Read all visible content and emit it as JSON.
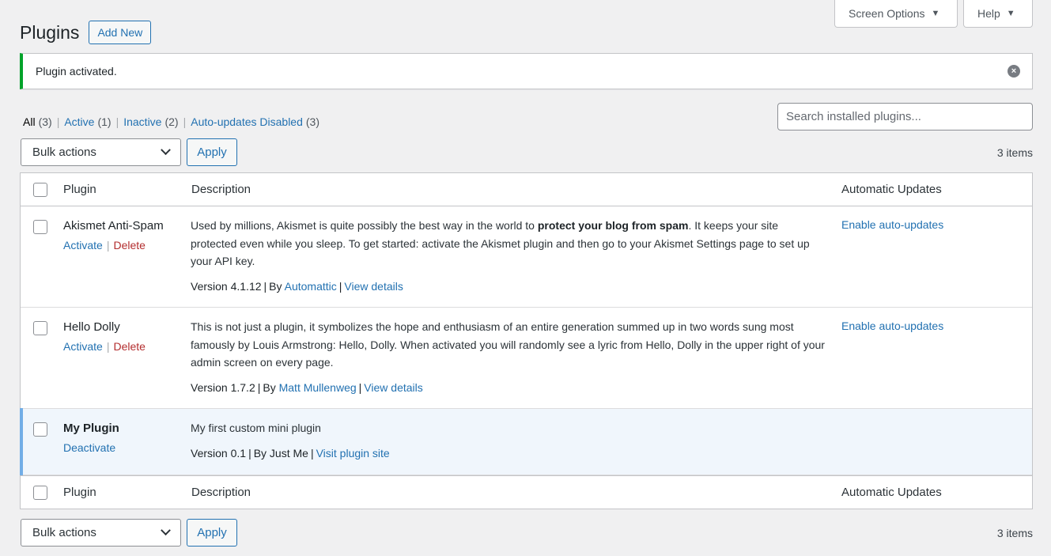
{
  "screen_meta": {
    "screen_options_label": "Screen Options",
    "help_label": "Help"
  },
  "header": {
    "title": "Plugins",
    "add_new_label": "Add New"
  },
  "notice": {
    "message": "Plugin activated.",
    "dismiss_icon": "×"
  },
  "filters": [
    {
      "label": "All",
      "count": "(3)"
    },
    {
      "label": "Active",
      "count": "(1)"
    },
    {
      "label": "Inactive",
      "count": "(2)"
    },
    {
      "label": "Auto-updates Disabled",
      "count": "(3)"
    }
  ],
  "search": {
    "placeholder": "Search installed plugins..."
  },
  "tablenav": {
    "bulk_actions_label": "Bulk actions",
    "apply_label": "Apply",
    "items_count": "3 items"
  },
  "table": {
    "columns": {
      "plugin": "Plugin",
      "description": "Description",
      "auto_updates": "Automatic Updates"
    },
    "rows": [
      {
        "name": "Akismet Anti-Spam",
        "action_primary": "Activate",
        "action_delete": "Delete",
        "desc_before": "Used by millions, Akismet is quite possibly the best way in the world to ",
        "desc_strong": "protect your blog from spam",
        "desc_after": ". It keeps your site protected even while you sleep. To get started: activate the Akismet plugin and then go to your Akismet Settings page to set up your API key.",
        "version": "Version 4.1.12",
        "by": "By",
        "author": "Automattic",
        "details_link": "View details",
        "auto_update_link": "Enable auto-updates"
      },
      {
        "name": "Hello Dolly",
        "action_primary": "Activate",
        "action_delete": "Delete",
        "desc_before": "This is not just a plugin, it symbolizes the hope and enthusiasm of an entire generation summed up in two words sung most famously by Louis Armstrong: Hello, Dolly. When activated you will randomly see a lyric from Hello, Dolly in the upper right of your admin screen on every page.",
        "version": "Version 1.7.2",
        "by": "By",
        "author": "Matt Mullenweg",
        "details_link": "View details",
        "auto_update_link": "Enable auto-updates"
      },
      {
        "name": "My Plugin",
        "action_primary": "Deactivate",
        "desc_before": "My first custom mini plugin",
        "version": "Version 0.1",
        "by_author": "By Just Me",
        "details_link": "Visit plugin site"
      }
    ]
  },
  "colors": {
    "link": "#2271b1",
    "delete": "#b32d2e",
    "notice_success": "#00a32a",
    "active_row_bg": "#f0f6fc",
    "active_row_border": "#72aee6"
  }
}
